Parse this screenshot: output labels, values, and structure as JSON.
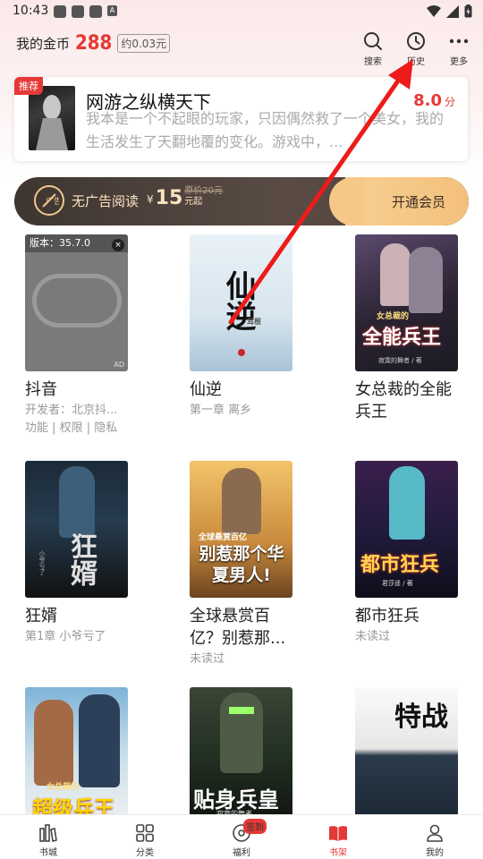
{
  "status_bar": {
    "time": "10:43"
  },
  "header": {
    "coins_label": "我的金币",
    "coins_value": "288",
    "coins_yuan": "约0.03元",
    "actions": [
      {
        "label": "搜索",
        "icon": "search-icon"
      },
      {
        "label": "历史",
        "icon": "clock-icon"
      },
      {
        "label": "更多",
        "icon": "more-icon"
      }
    ]
  },
  "recommend": {
    "badge": "推荐",
    "title": "网游之纵横天下",
    "desc": "我本是一个不起眼的玩家，只因偶然救了一个美女，我的生活发生了天翻地覆的变化。游戏中，...",
    "score": "8.0",
    "score_unit": "分"
  },
  "vip": {
    "icon_text": "广告",
    "text": "无广告阅读",
    "currency": "¥",
    "price": "15",
    "unit": "元起",
    "original": "原价20元",
    "open_label": "开通会员"
  },
  "books": [
    {
      "title": "抖音",
      "sub1": "开发者：北京抖...",
      "sub2": "功能 | 权限 | 隐私",
      "ad_version": "版本：35.7.0",
      "ad_tag": "AD",
      "ad_close": "×"
    },
    {
      "title": "仙逆",
      "sub1": "第一章 离乡",
      "cover_text": "仙逆",
      "cover_sub": "耳根"
    },
    {
      "title": "女总裁的全能兵王",
      "sub1": "",
      "cover_text": "全能兵王",
      "cover_top": "女总裁的",
      "cover_author": "寂寞的舞者 / 著"
    },
    {
      "title": "狂婿",
      "sub1": "第1章 小爷亏了",
      "cover_text": "狂婿",
      "cover_author": "小爷亏了"
    },
    {
      "title": "全球悬赏百亿？别惹那...",
      "sub1": "未读过",
      "cover_text": "别惹那个华夏男人!",
      "cover_top": "全球悬赏百亿"
    },
    {
      "title": "都市狂兵",
      "sub1": "未读过",
      "cover_text": "都市狂兵",
      "cover_author": "君莎遥 / 著"
    },
    {
      "title": "",
      "sub1": "",
      "cover_text": "超级兵王",
      "cover_top": "女总裁的"
    },
    {
      "title": "",
      "sub1": "",
      "cover_text": "贴身兵皇",
      "cover_author": "寂寞的舞者"
    },
    {
      "title": "",
      "sub1": "",
      "cover_text": "特战"
    }
  ],
  "tabs": [
    {
      "label": "书城",
      "icon": "bookstore-icon"
    },
    {
      "label": "分类",
      "icon": "category-icon"
    },
    {
      "label": "福利",
      "icon": "welfare-icon",
      "badge": "签到"
    },
    {
      "label": "书架",
      "icon": "bookshelf-icon",
      "active": true
    },
    {
      "label": "我的",
      "icon": "profile-icon"
    }
  ],
  "colors": {
    "accent": "#e53935",
    "vip_dark": "#3e3530",
    "vip_gold": "#f6c888",
    "annotation_arrow": "#ee1b1b"
  }
}
